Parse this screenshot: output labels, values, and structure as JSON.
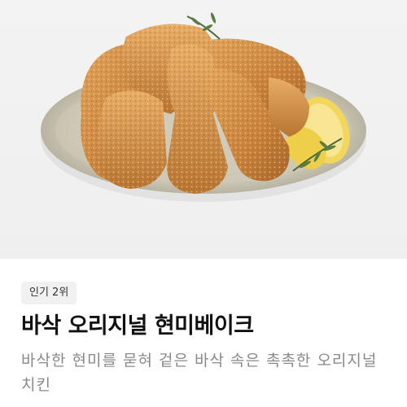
{
  "product": {
    "image_alt_icon": "fried-chicken-dish-image",
    "badge": "인기 2위",
    "name": "바삭 오리지널 현미베이크",
    "description": "바삭한 현미를 묻혀 겉은 바삭 속은 촉촉한 오리지널 치킨"
  },
  "colors": {
    "background": "#ffffff",
    "hero_bg": "#f0f0f0",
    "title": "#111111",
    "description": "#8a8a8a",
    "badge_bg": "#f1f1f1"
  }
}
